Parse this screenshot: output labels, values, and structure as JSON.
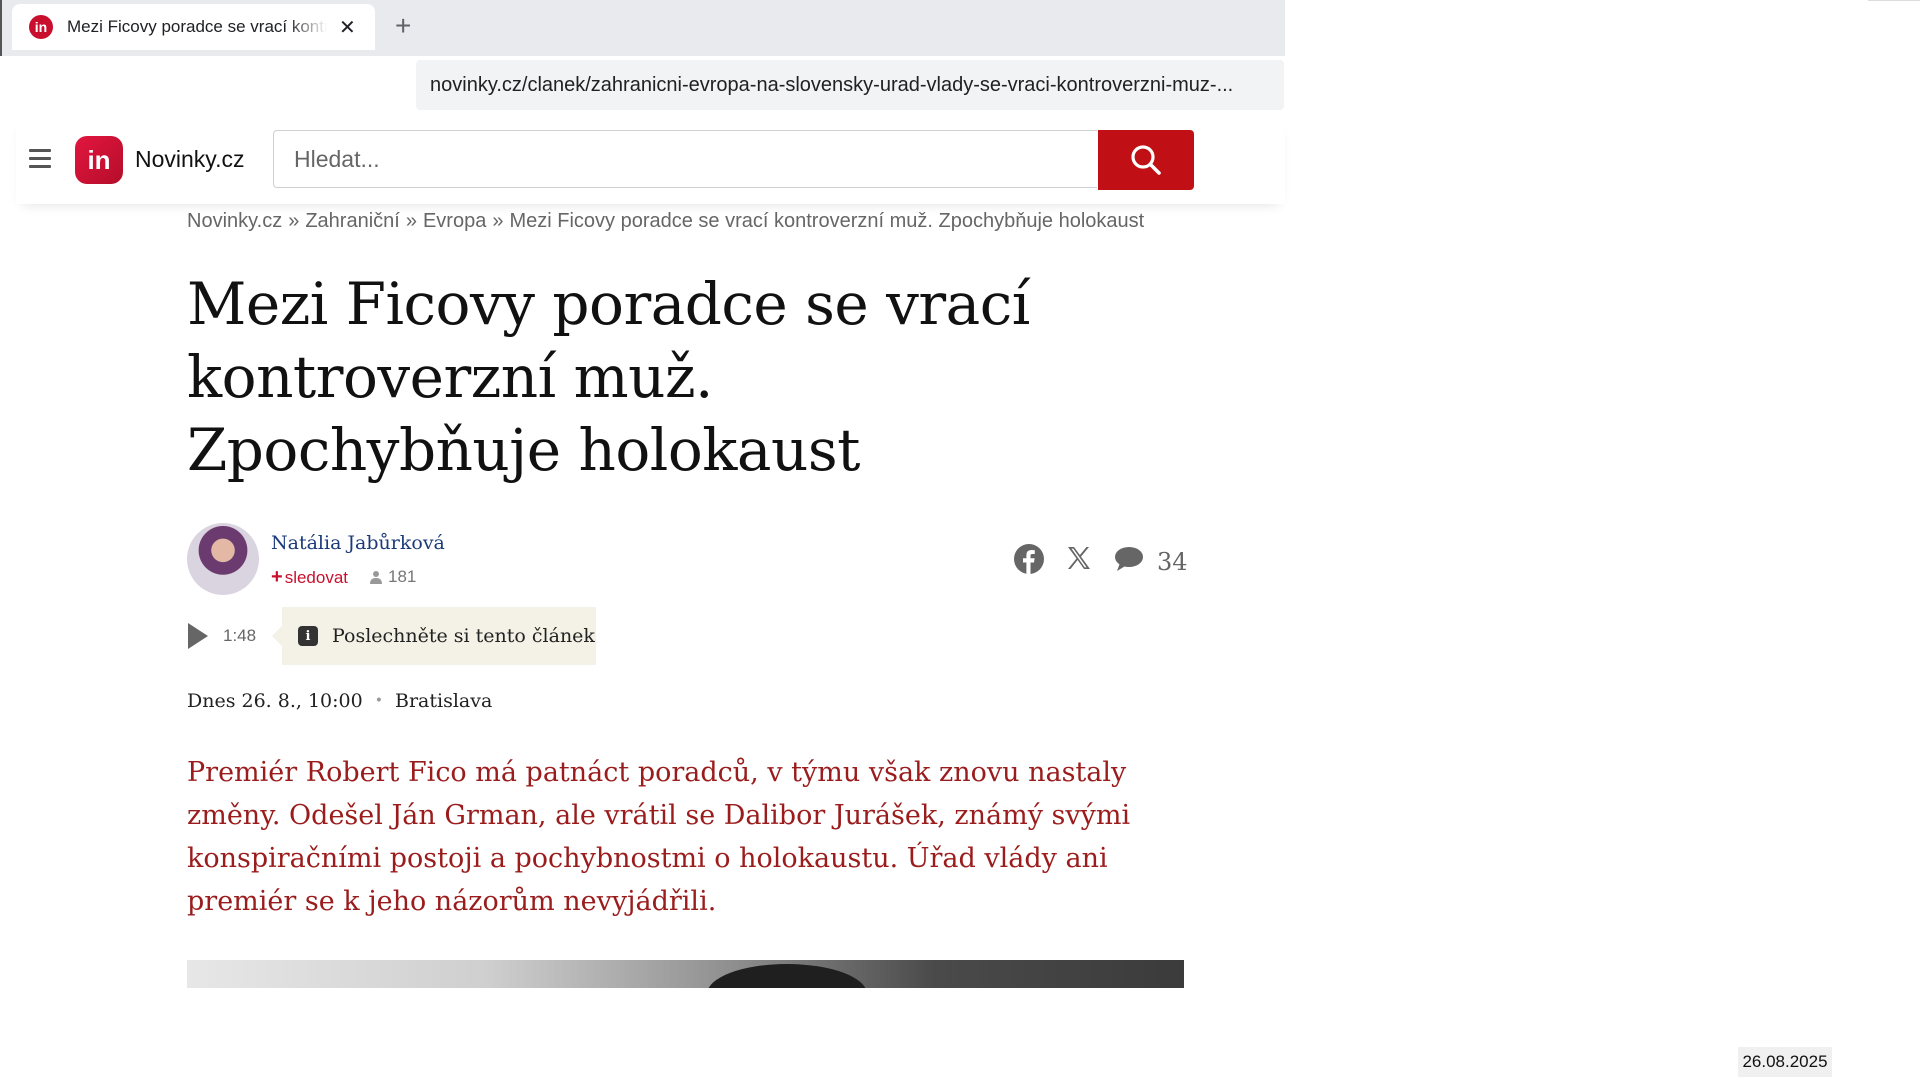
{
  "browser": {
    "tab_title": "Mezi Ficovy poradce se vrací kontroverzní muž. Zpochybňuje holokaust",
    "tab_favicon": "in",
    "tab_close": "✕",
    "new_tab": "+",
    "url": "novinky.cz/clanek/zahranicni-evropa-na-slovensky-urad-vlady-se-vraci-kontroverzni-muz-..."
  },
  "header": {
    "logo_badge": "in",
    "logo_text": "Novinky.cz",
    "search_placeholder": "Hledat...",
    "brand_color": "#c00f15"
  },
  "breadcrumb": {
    "items": [
      "Novinky.cz",
      "Zahraniční",
      "Evropa",
      "Mezi Ficovy poradce se vrací kontroverzní muž. Zpochybňuje holokaust"
    ],
    "separator": "»"
  },
  "article": {
    "headline": "Mezi Ficovy poradce se vrací kontroverzní muž. Zpochybňuje holokaust",
    "author": {
      "name": "Natália Jabůrková",
      "follow_label": "sledovat",
      "follow_plus": "+",
      "followers": "181"
    },
    "comment_count": "34",
    "audio": {
      "duration": "1:48",
      "listen_label": "Poslechněte si tento článek",
      "info_icon": "i"
    },
    "date": "Dnes 26. 8., 10:00",
    "dot": "•",
    "location": "Bratislava",
    "perex": "Premiér Robert Fico má patnáct poradců, v týmu však znovu nastaly změny. Odešel Ján Grman, ale vrátil se Dalibor Jurášek, známý svými konspiračními postoji a pochybnostmi o holokaustu. Úřad vlády ani premiér se k jeho názorům nevyjádřili."
  },
  "taskbar": {
    "date": "26.08.2025"
  },
  "icons": {
    "menu": "hamburger-icon",
    "search": "search-icon",
    "facebook": "facebook-icon",
    "x": "x-twitter-icon",
    "comments": "comment-icon",
    "play": "play-icon",
    "person": "person-icon"
  }
}
